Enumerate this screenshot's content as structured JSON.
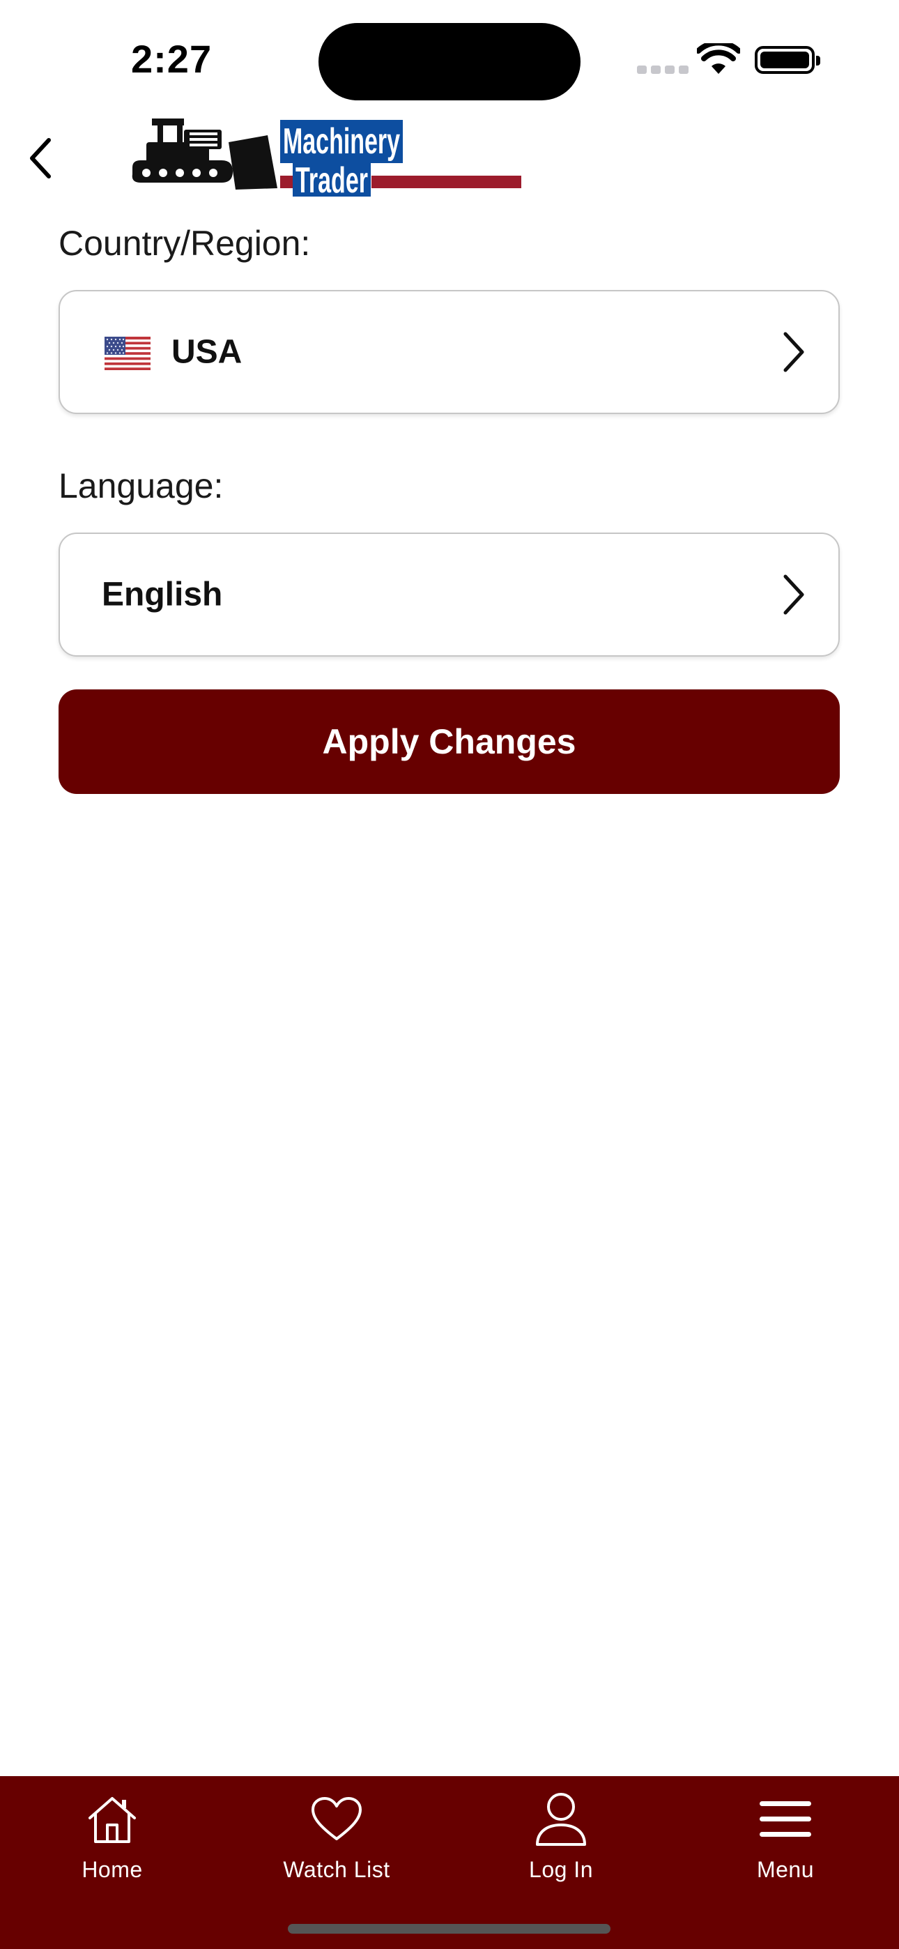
{
  "status_bar": {
    "time": "2:27"
  },
  "header": {
    "logo_line1": "Machinery",
    "logo_line2": "Trader",
    "back_icon": "chevron-left-icon"
  },
  "form": {
    "country_label": "Country/Region:",
    "country_value": "USA",
    "country_flag_icon": "us-flag-icon",
    "language_label": "Language:",
    "language_value": "English",
    "apply_label": "Apply Changes"
  },
  "tab_bar": {
    "items": [
      {
        "label": "Home",
        "icon": "home-icon"
      },
      {
        "label": "Watch List",
        "icon": "heart-icon"
      },
      {
        "label": "Log In",
        "icon": "person-icon"
      },
      {
        "label": "Menu",
        "icon": "menu-icon"
      }
    ],
    "selected": "Menu"
  },
  "colors": {
    "brand": "#670000",
    "logo_blue": "#0d4ea0",
    "logo_red": "#9c1c2c"
  }
}
